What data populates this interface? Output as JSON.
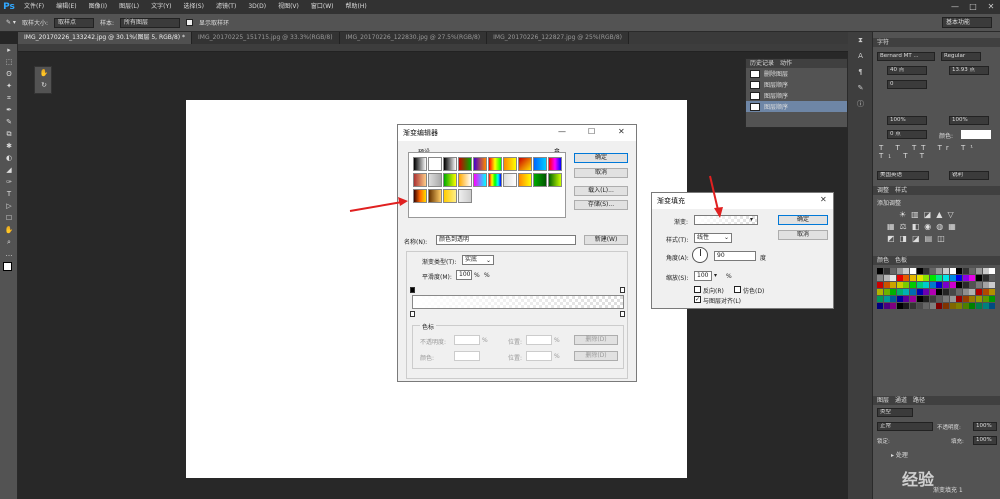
{
  "app": {
    "logo": "Ps"
  },
  "menu": [
    "文件(F)",
    "编辑(E)",
    "图像(I)",
    "图层(L)",
    "文字(Y)",
    "选择(S)",
    "滤镜(T)",
    "3D(D)",
    "视图(V)",
    "窗口(W)",
    "帮助(H)"
  ],
  "window_controls": [
    "—",
    "□",
    "✕"
  ],
  "options": {
    "size_label": "取样大小:",
    "size_value": "取样点",
    "sample_label": "样本:",
    "sample_value": "所有图层",
    "show_ring": "显示取样环",
    "workspace": "基本功能"
  },
  "tabs": [
    "IMG_20170226_133242.jpg @ 30.1%(图层 5, RGB/8) *",
    "IMG_20170225_151715.jpg @ 33.3%(RGB/8)",
    "IMG_20170226_122830.jpg @ 27.5%(RGB/8)",
    "IMG_20170226_122827.jpg @ 25%(RGB/8)"
  ],
  "tools": [
    "▸",
    "⬚",
    "ʘ",
    "✦",
    "⌗",
    "✒",
    "✎",
    "⧉",
    "✱",
    "◐",
    "◢",
    "✑",
    "T",
    "▷",
    "☐",
    "✋",
    "⌕",
    "…"
  ],
  "history": {
    "tabs": [
      "历史记录",
      "动作"
    ],
    "items": [
      "删除图层",
      "图层顺序",
      "图层顺序",
      "图层顺序"
    ]
  },
  "character": {
    "tab": "字符",
    "font": "Bernard MT ...",
    "style": "Regular",
    "size": "40 点",
    "leading": "13.93 点",
    "tracking": "0",
    "scale_v": "100%",
    "scale_h": "100%",
    "shift": "0 点",
    "color_label": "颜色:",
    "lang": "美国英语",
    "aa": "锐利"
  },
  "adjustments": {
    "tabs": [
      "调整",
      "样式"
    ],
    "title": "添加调整"
  },
  "swatches": {
    "tabs": [
      "颜色",
      "色板"
    ]
  },
  "layers": {
    "tabs": [
      "图层",
      "通道",
      "路径"
    ],
    "kind": "类型",
    "mode": "正常",
    "opacity_label": "不透明度:",
    "opacity": "100%",
    "lock_label": "锁定:",
    "fill_label": "填充:",
    "fill": "100%",
    "layer_name": "渐变填充 1",
    "group": "处理"
  },
  "gradient_editor": {
    "title": "渐变编辑器",
    "presets_label": "预设",
    "ok": "确定",
    "cancel": "取消",
    "load": "载入(L)...",
    "save": "存储(S)...",
    "name_label": "名称(N):",
    "name_value": "颜色到透明",
    "new": "新建(W)",
    "type_label": "渐变类型(T):",
    "type_value": "实底",
    "smooth_label": "平滑度(M):",
    "smooth_value": "100",
    "percent": "%",
    "stops_label": "色标",
    "opacity_label": "不透明度:",
    "location_label": "位置:",
    "delete": "删除(D)",
    "color_label": "颜色:"
  },
  "gradient_fill": {
    "title": "渐变填充",
    "gradient_label": "渐变:",
    "ok": "确定",
    "cancel": "取消",
    "style_label": "样式(T):",
    "style_value": "线性",
    "angle_label": "角度(A):",
    "angle_value": "90",
    "angle_unit": "度",
    "scale_label": "缩放(S):",
    "scale_value": "100",
    "percent": "%",
    "reverse": "反向(R)",
    "dither": "仿色(D)",
    "align": "与图层对齐(L)"
  },
  "watermark": "经验"
}
